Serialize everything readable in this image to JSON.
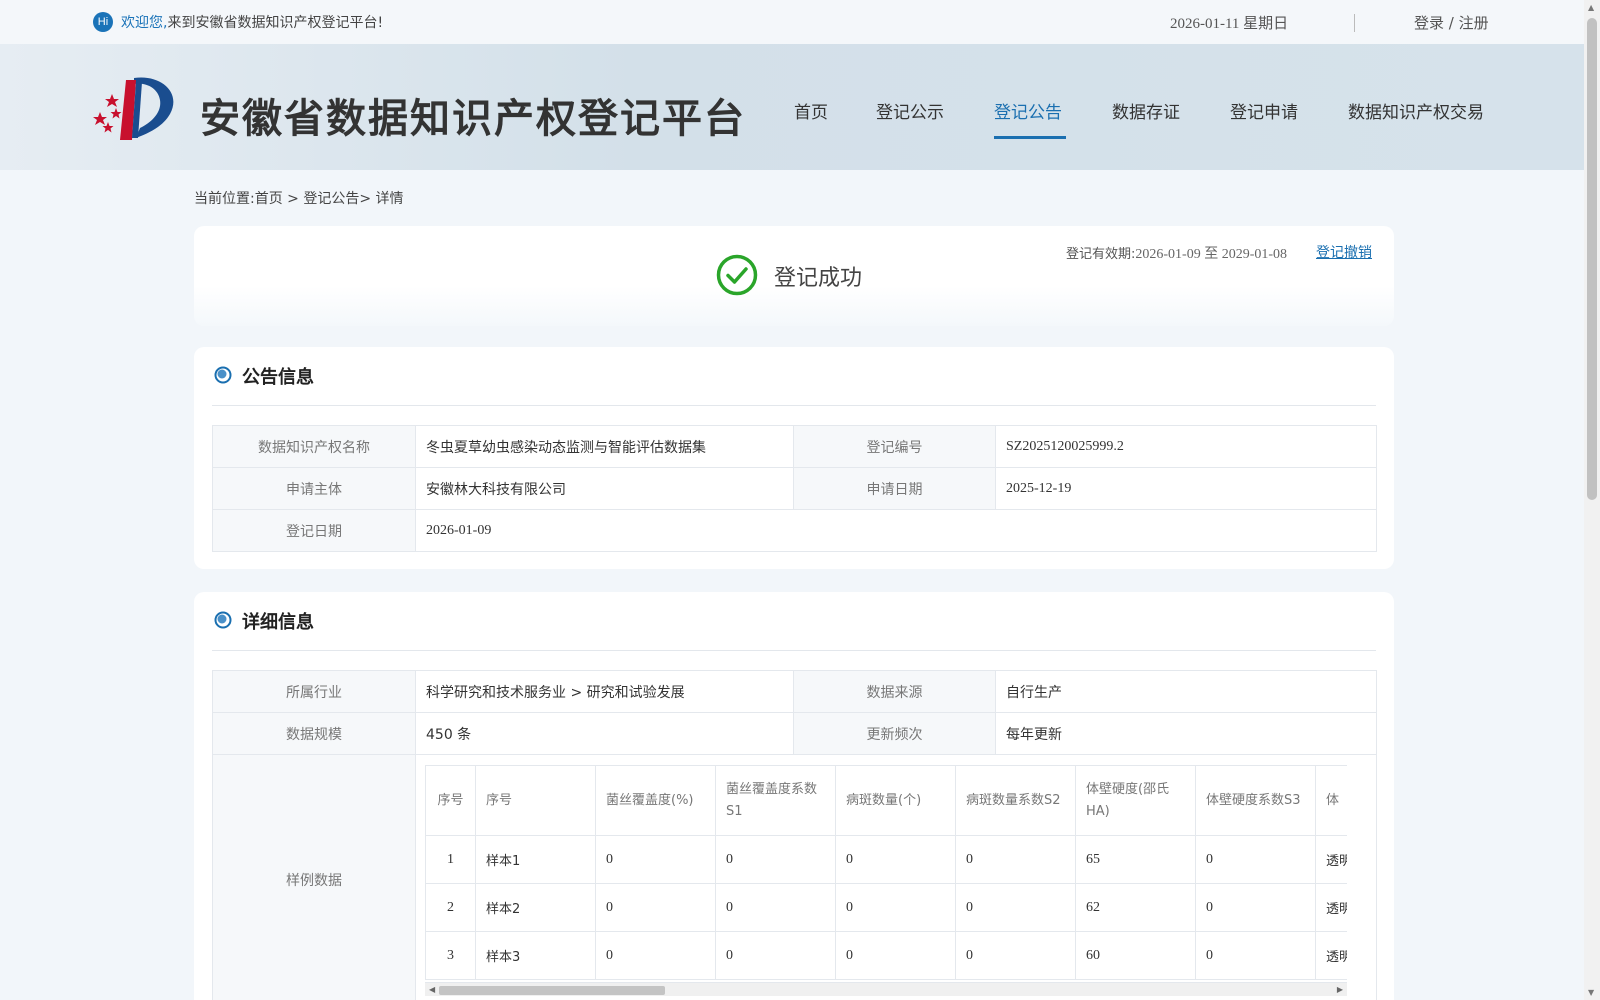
{
  "topbar": {
    "hi": "Hi",
    "welcome_highlight": "欢迎您,",
    "welcome_rest": "来到安徽省数据知识产权登记平台!",
    "date": "2026-01-11 星期日",
    "login": "登录 / 注册"
  },
  "header": {
    "title": "安徽省数据知识产权登记平台",
    "nav": [
      "首页",
      "登记公示",
      "登记公告",
      "数据存证",
      "登记申请",
      "数据知识产权交易"
    ],
    "active_nav": "登记公告"
  },
  "breadcrumb": "当前位置:首页 > 登记公告> 详情",
  "status": {
    "text": "登记成功",
    "validity_label": "登记有效期:",
    "validity_value": "2026-01-09 至 2029-01-08",
    "revoke": "登记撤销",
    "color": "#2aa52a"
  },
  "notice": {
    "title": "公告信息",
    "name_label": "数据知识产权名称",
    "name_value": "冬虫夏草幼虫感染动态监测与智能评估数据集",
    "reg_no_label": "登记编号",
    "reg_no_value": "SZ2025120025999.2",
    "applicant_label": "申请主体",
    "applicant_value": "安徽林大科技有限公司",
    "apply_date_label": "申请日期",
    "apply_date_value": "2025-12-19",
    "reg_date_label": "登记日期",
    "reg_date_value": "2026-01-09"
  },
  "detail": {
    "title": "详细信息",
    "industry_label": "所属行业",
    "industry_value": "科学研究和技术服务业 > 研究和试验发展",
    "source_label": "数据来源",
    "source_value": "自行生产",
    "scale_label": "数据规模",
    "scale_value": "450 条",
    "freq_label": "更新频次",
    "freq_value": "每年更新",
    "sample_label": "样例数据",
    "sample_columns": [
      "序号",
      "序号",
      "菌丝覆盖度(%)",
      "菌丝覆盖度系数S1",
      "病斑数量(个)",
      "病斑数量系数S2",
      "体壁硬度(邵氏HA)",
      "体壁硬度系数S3",
      "体"
    ],
    "sample_rows": [
      [
        "1",
        "样本1",
        "0",
        "0",
        "0",
        "0",
        "65",
        "0",
        "透明"
      ],
      [
        "2",
        "样本2",
        "0",
        "0",
        "0",
        "0",
        "62",
        "0",
        "透明"
      ],
      [
        "3",
        "样本3",
        "0",
        "0",
        "0",
        "0",
        "60",
        "0",
        "透明"
      ]
    ]
  },
  "colors": {
    "accent": "#1a6fb0",
    "success": "#2aa52a"
  }
}
